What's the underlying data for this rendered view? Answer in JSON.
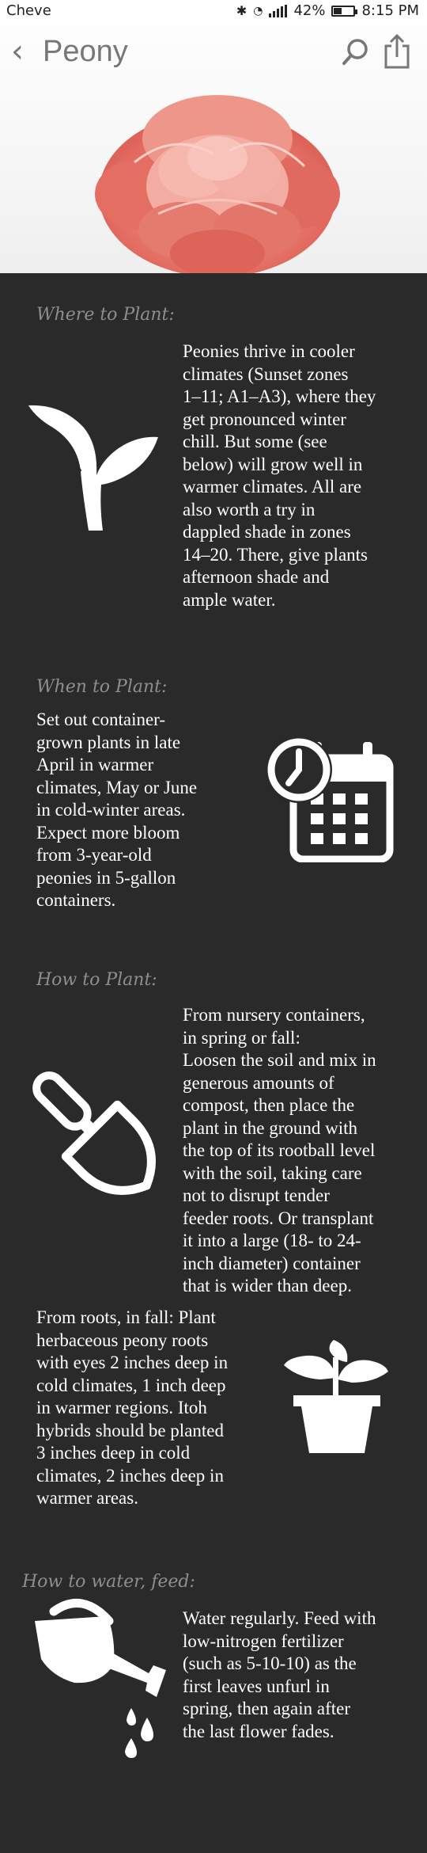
{
  "status_bar": {
    "carrier": "Cheve",
    "battery": "42%",
    "time": "8:15 PM",
    "battery_level": 0.42
  },
  "header": {
    "back_icon": "chevron-left-icon",
    "title": "Peony",
    "search_icon": "search-icon",
    "share_icon": "share-icon"
  },
  "hero": {
    "image": "pink-peony-flower"
  },
  "sections": {
    "where": {
      "heading": "Where to Plant:",
      "text": "Peonies thrive in cooler\nclimates (Sunset zones\n1–11; A1–A3), where they\nget pronounced winter\nchill. But some (see\nbelow) will grow well in\nwarmer climates. All are\nalso worth a try in\ndappled shade in zones\n14–20. There, give plants\nafternoon shade and\nample water.",
      "icon": "sprout-icon"
    },
    "when": {
      "heading": "When to Plant:",
      "text": "Set out container-\ngrown plants in late\nApril in warmer\nclimates, May or June\nin cold-winter areas.\nExpect more bloom\nfrom 3-year-old\npeonies in 5-gallon\ncontainers.",
      "icon": "calendar-clock-icon"
    },
    "how": {
      "heading": "How to Plant:",
      "text1": "From nursery containers,\nin spring or fall:\nLoosen the soil and mix in\ngenerous amounts of\ncompost, then place the\nplant in the ground with\nthe top of its rootball level\nwith the soil, taking care\nnot to disrupt tender\nfeeder roots. Or transplant\nit into a large (18- to 24-\ninch diameter) container\nthat is wider than deep.",
      "text2": "From roots, in fall: Plant\nherbaceous peony roots\nwith eyes 2 inches deep in\ncold climates, 1 inch deep\nin warmer regions. Itoh\nhybrids should be planted\n3 inches deep in cold\nclimates, 2 inches deep in\nwarmer areas.",
      "icon1": "trowel-icon",
      "icon2": "potted-plant-icon"
    },
    "water": {
      "heading": "How to water, feed:",
      "text": "Water regularly. Feed with\nlow-nitrogen fertilizer\n(such as 5-10-10) as the\nfirst leaves unfurl in\nspring, then again after\nthe last flower fades.",
      "icon": "watering-can-icon"
    }
  }
}
